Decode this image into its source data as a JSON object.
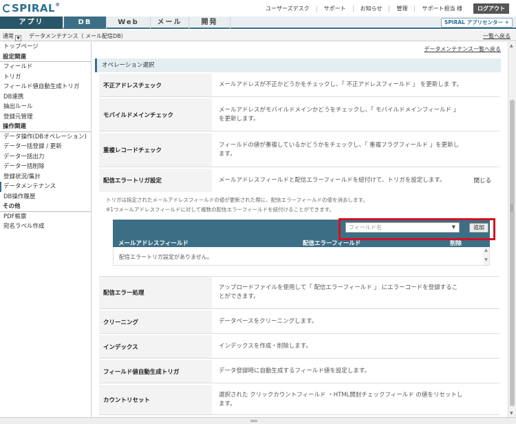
{
  "logo": {
    "text": "SPIRAL",
    "reg": "®"
  },
  "toplinks": [
    "ユーザーズデスク",
    "サポート",
    "お知らせ",
    "管理",
    "サポート担当 様"
  ],
  "logout": "ログアウト",
  "tabs": [
    "アプリ",
    "DB",
    "Web",
    "メール",
    "開発"
  ],
  "appcenter": "SPIRAL アプリセンター",
  "breadcrumb": {
    "mode": "通常",
    "path": "データメンテナンス（ メール配信DB）",
    "back": "一覧へ戻る"
  },
  "sidebar": {
    "top": "トップページ",
    "groups": [
      {
        "heading": "設定関連",
        "items": [
          "フィールド",
          "トリガ",
          "フィールド値自動生成トリガ",
          "DB連携",
          "抽出ルール",
          "登録元管理"
        ]
      },
      {
        "heading": "操作関連",
        "items": [
          "データ操作(DBオペレーション)",
          "データ一括登録 / 更新",
          "データ一括出力",
          "データ一括削除",
          "登録状況/集計",
          "データメンテナンス",
          "DB操作履歴"
        ]
      },
      {
        "heading": "その他",
        "items": [
          "PDF帳票",
          "宛名ラベル作成"
        ]
      }
    ]
  },
  "main": {
    "list_link": "データメンテナンス一覧へ戻る",
    "section_title": "オペレーション選択",
    "ops": [
      {
        "label": "不正アドレスチェック",
        "desc": "メールアドレスが不正かどうかをチェックし、「 不正アドレスフィールド 」 を更新しま す。"
      },
      {
        "label": "モバイルドメインチェック",
        "desc": "メールアドレスがモバイルドメインかどうをチェックし、「 モバイルドメインフィールド 」 を更新します。"
      },
      {
        "label": "重複レコードチェック",
        "desc": "フィールドの値が重複しているかどうかをチェックし、「 重複フラグフィールド 」を更新し ます。"
      },
      {
        "label": "配信エラートリガ設定",
        "desc": "メールアドレスフィールドと配信エラーフィールドを紐付けて、トリガを設定します。",
        "close": "閉じる"
      },
      {
        "label": "配信エラー処理",
        "desc": "アップロードファイルを使用して「 配信エラーフィールド 」 にエラーコードを登録するこ とができます。"
      },
      {
        "label": "クリーニング",
        "desc": "データベースをクリーニングします。"
      },
      {
        "label": "インデックス",
        "desc": "インデックスを作成・削除します。"
      },
      {
        "label": "フィールド値自動生成トリガ",
        "desc": "データ登録時に自動生成するフィールド値を設定します。"
      },
      {
        "label": "カウントリセット",
        "desc": "選択された クリックカウントフィールド ・HTML開封チェックフィールド の値をリセットし ます。"
      }
    ],
    "trigger": {
      "note1": "トリガは指定されたメールアドレスフィールドの値が更新された際に、配信エラーフィールドの値を消去します。",
      "note2": "※1つメールアドレスフィールドに対して複数の配信エラーフィールドを紐付けることができます。",
      "select_placeholder": "フィールド名",
      "add_label": "追加",
      "col1": "メールアドレスフィールド",
      "col2": "配信エラーフィールド",
      "col3": "削除",
      "empty": "配信エラートリガ設定がありません。"
    }
  }
}
